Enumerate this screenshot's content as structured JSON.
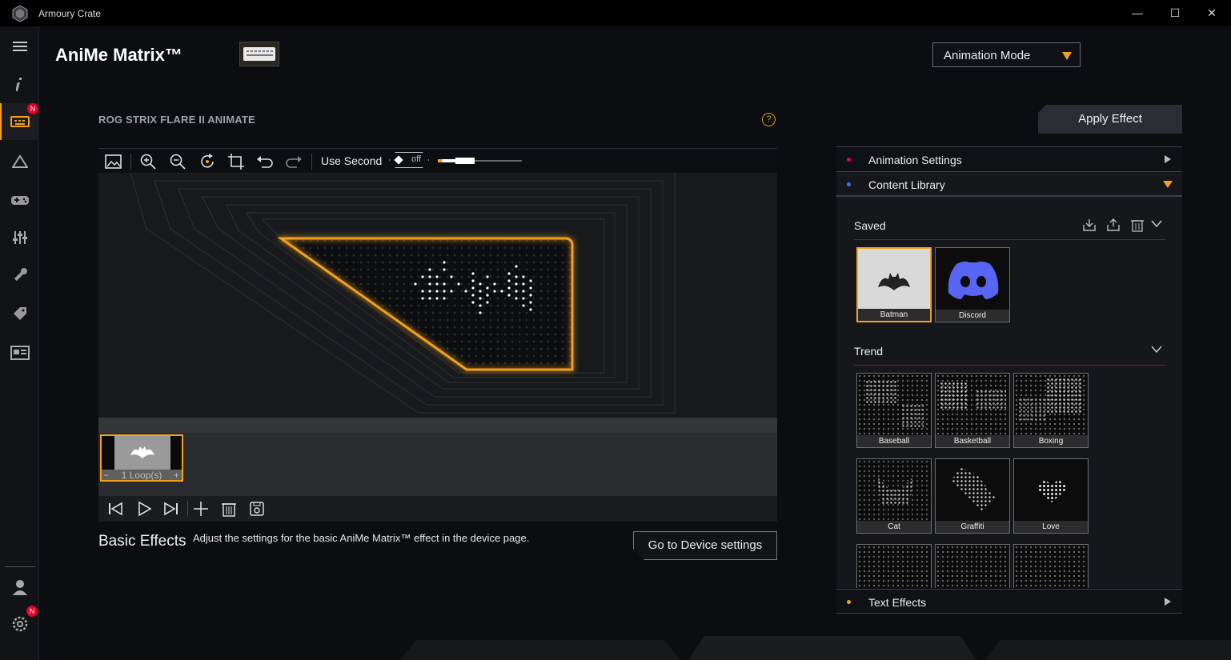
{
  "window": {
    "title": "Armoury Crate",
    "minimize": "—",
    "maximize": "☐",
    "close": "✕"
  },
  "sidebar": {
    "items": [
      {
        "name": "menu-icon"
      },
      {
        "name": "info-icon"
      },
      {
        "name": "keyboard-device-icon",
        "badge": "N",
        "active": true
      },
      {
        "name": "aura-icon"
      },
      {
        "name": "game-icon"
      },
      {
        "name": "equalizer-icon"
      },
      {
        "name": "tools-icon"
      },
      {
        "name": "deals-tag-icon"
      },
      {
        "name": "news-icon"
      }
    ],
    "bottom": [
      {
        "name": "user-icon"
      },
      {
        "name": "settings-gear-icon",
        "badge": "N"
      }
    ]
  },
  "header": {
    "title": "AniMe Matrix™",
    "mode": "Animation Mode"
  },
  "device": {
    "name": "ROG STRIX FLARE II ANIMATE",
    "help": "?"
  },
  "apply_button": "Apply Effect",
  "toolbar": {
    "icons": [
      "image-icon",
      "zoom-in-icon",
      "zoom-out-icon",
      "rotate-icon",
      "crop-icon",
      "undo-icon",
      "redo-icon"
    ],
    "use_second_label": "Use Second",
    "toggle_value": "off"
  },
  "timeline": {
    "frame_loop": "1 Loop(s)",
    "minus": "−",
    "plus": "+"
  },
  "playbar": {
    "icons": [
      "skip-back-icon",
      "play-icon",
      "skip-forward-icon",
      "add-icon",
      "trash-icon",
      "save-icon"
    ]
  },
  "basic_effects": {
    "title": "Basic Effects",
    "description": "Adjust the settings for the basic AniMe Matrix™ effect in the device page.",
    "button": "Go to Device settings"
  },
  "right_panel": {
    "animation_settings": "Animation Settings",
    "content_library": "Content Library",
    "text_effects": "Text Effects",
    "saved_title": "Saved",
    "saved_items": [
      "Batman",
      "Discord"
    ],
    "trend_title": "Trend",
    "trend_items": [
      "Baseball",
      "Basketball",
      "Boxing",
      "Cat",
      "Graffiti",
      "Love"
    ]
  },
  "colors": {
    "accent": "#f3a11b",
    "pink_dot": "#e8005c",
    "blue_dot": "#2a7bff",
    "orange_dot": "#f3a11b",
    "discord": "#5865f2"
  }
}
